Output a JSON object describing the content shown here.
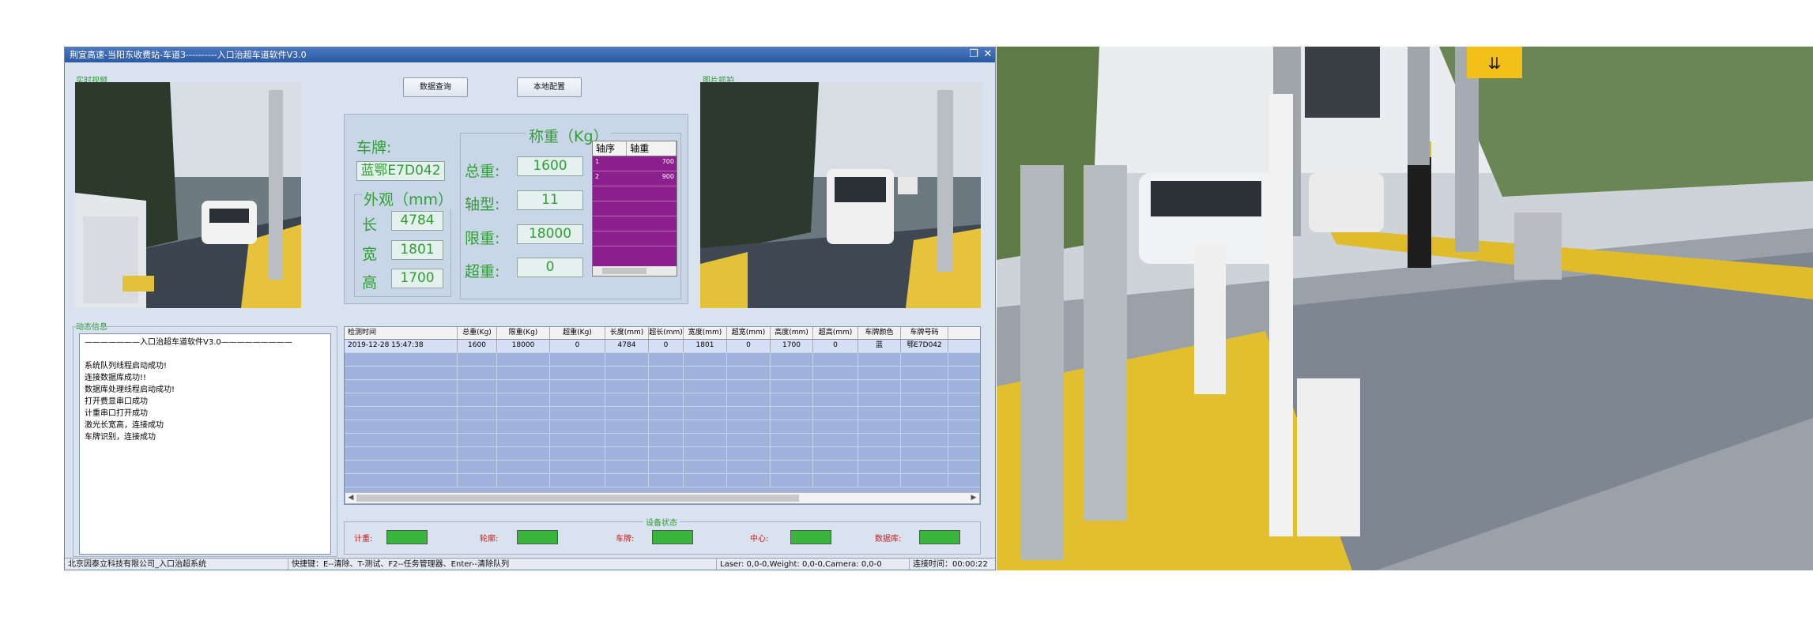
{
  "window": {
    "title": "荆宜高速-当阳东收费站-车道3----------入口治超车道软件V3.0"
  },
  "sections": {
    "realtime_video": "实时视频",
    "tail_capture": "图片抓拍",
    "dynamic_info": "动态信息",
    "device_status": "设备状态"
  },
  "buttons": {
    "data_query": "数据查询",
    "local_config": "本地配置"
  },
  "vehicle": {
    "plate_label": "车牌:",
    "plate_value": "蓝鄂E7D042",
    "appearance_label": "外观（mm）",
    "length_label": "长",
    "length_value": "4784",
    "width_label": "宽",
    "width_value": "1801",
    "height_label": "高",
    "height_value": "1700"
  },
  "weight": {
    "title": "称重（Kg）",
    "total_label": "总重:",
    "total_value": "1600",
    "axle_type_label": "轴型:",
    "axle_type_value": "11",
    "limit_label": "限重:",
    "limit_value": "18000",
    "over_label": "超重:",
    "over_value": "0",
    "axle_table": {
      "headers": [
        "轴序",
        "轴重"
      ],
      "rows": [
        [
          "1",
          "700"
        ],
        [
          "2",
          "900"
        ]
      ]
    }
  },
  "log": {
    "lines": [
      "———————入口治超车道软件V3.0—————————",
      "",
      "系统队列线程启动成功!",
      "连接数据库成功!!",
      "数据库处理线程启动成功!",
      "打开费显串口成功",
      "计重串口打开成功",
      "激光长宽高，连接成功",
      "车牌识别，连接成功"
    ]
  },
  "grid": {
    "columns": [
      "检测时间",
      "总重(Kg)",
      "限重(Kg)",
      "超重(Kg)",
      "长度(mm)",
      "超长(mm)",
      "宽度(mm)",
      "超宽(mm)",
      "高度(mm)",
      "超高(mm)",
      "车牌颜色",
      "车牌号码"
    ],
    "rows": [
      [
        "2019-12-28 15:47:38",
        "1600",
        "18000",
        "0",
        "4784",
        "0",
        "1801",
        "0",
        "1700",
        "0",
        "蓝",
        "鄂E7D042"
      ]
    ]
  },
  "devices": [
    {
      "label": "计重:",
      "status_color": "#3ab53c"
    },
    {
      "label": "轮廓:",
      "status_color": "#3ab53c"
    },
    {
      "label": "车牌:",
      "status_color": "#3ab53c"
    },
    {
      "label": "中心:",
      "status_color": "#3ab53c"
    },
    {
      "label": "数据库:",
      "status_color": "#3ab53c"
    }
  ],
  "statusbar": {
    "company": "北京因泰立科技有限公司_入口治超系统",
    "shortcuts": "快捷键：E--清除、T-测试、F2--任务管理器、Enter--清除队列",
    "sensors": "Laser: 0,0-0,Weight: 0,0-0,Camera: 0,0-0",
    "uptime": "连接时间：00:00:22"
  }
}
